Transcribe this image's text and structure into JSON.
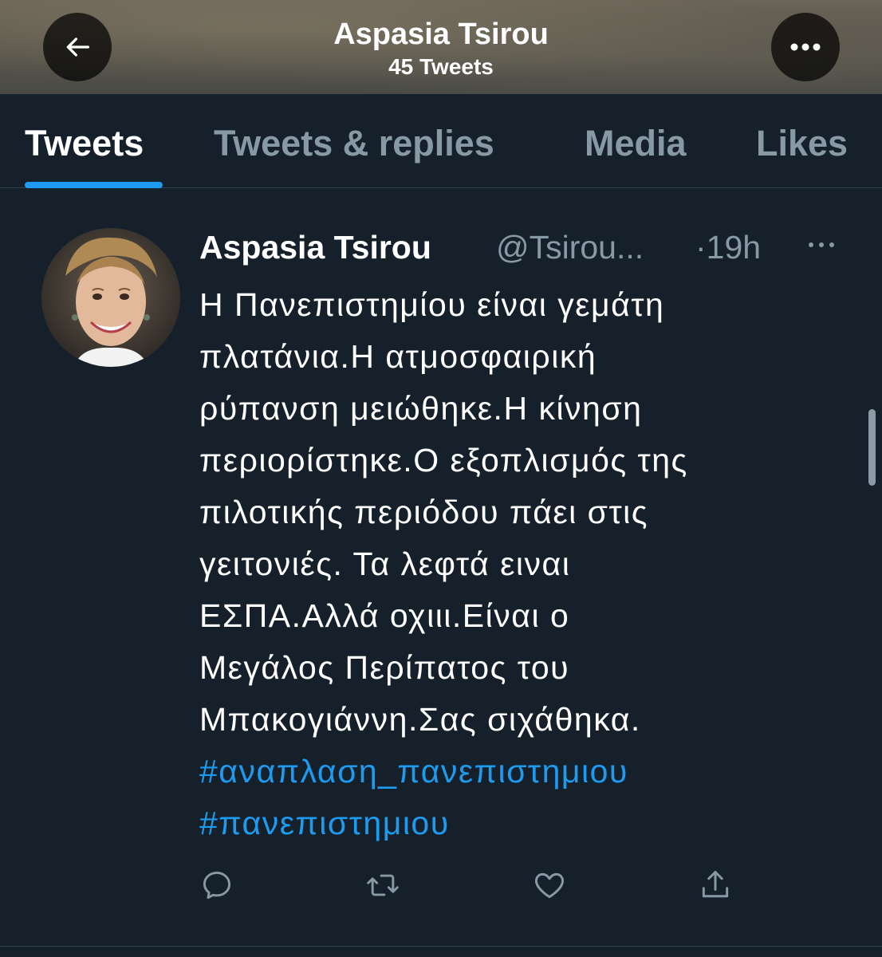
{
  "header": {
    "title": "Aspasia Tsirou",
    "subtitle": "45 Tweets",
    "back_icon": "arrow-left-icon",
    "more_icon": "more-horizontal-icon"
  },
  "tabs": [
    {
      "label": "Tweets",
      "active": true
    },
    {
      "label": "Tweets & replies",
      "active": false
    },
    {
      "label": "Media",
      "active": false
    },
    {
      "label": "Likes",
      "active": false
    }
  ],
  "tweet": {
    "name": "Aspasia Tsirou",
    "handle": "@Tsirou...",
    "time": "·19h",
    "lines": [
      "Η Πανεπιστημίου είναι γεμάτη",
      "πλατάνια.Η ατμοσφαιρική",
      "ρύπανση μειώθηκε.Η κίνηση",
      "περιορίστηκε.Ο εξοπλισμός της",
      "πιλοτικής περιόδου πάει στις",
      "γειτονιές. Τα λεφτά ειναι",
      "ΕΣΠΑ.Αλλά οχιιι.Είναι ο",
      "Μεγάλος Περίπατος του",
      "Μπακογιάννη.Σας σιχάθηκα."
    ],
    "hashtags": [
      "#αναπλαση_πανεπιστημιου",
      "#πανεπιστημιου"
    ],
    "actions": [
      "reply-icon",
      "retweet-icon",
      "like-icon",
      "share-icon"
    ]
  },
  "colors": {
    "background": "#15202b",
    "accent": "#1d9bf0",
    "secondary_text": "#8899a6",
    "divider": "#38444d"
  }
}
